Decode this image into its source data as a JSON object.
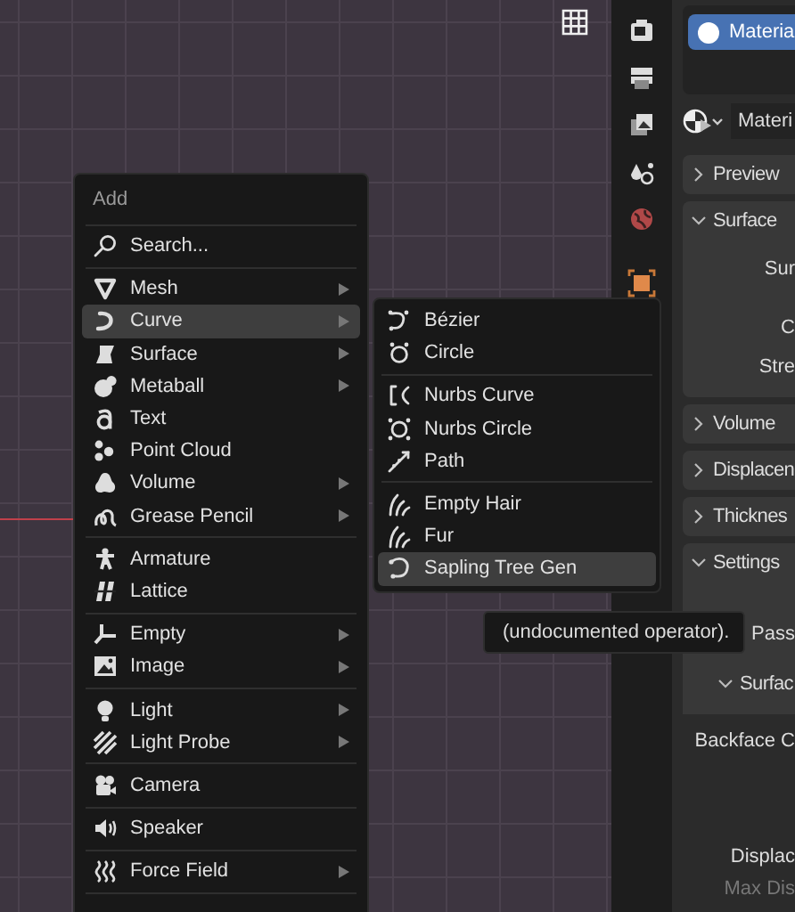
{
  "viewport": {
    "menu": {
      "title": "Add",
      "sections": [
        {
          "items": [
            {
              "label": "Search...",
              "has_submenu": false,
              "selected": false
            }
          ]
        },
        {
          "items": [
            {
              "label": "Mesh",
              "has_submenu": true,
              "selected": false
            },
            {
              "label": "Curve",
              "has_submenu": true,
              "selected": true
            },
            {
              "label": "Surface",
              "has_submenu": true,
              "selected": false
            },
            {
              "label": "Metaball",
              "has_submenu": true,
              "selected": false
            },
            {
              "label": "Text",
              "has_submenu": false,
              "selected": false
            },
            {
              "label": "Point Cloud",
              "has_submenu": false,
              "selected": false
            },
            {
              "label": "Volume",
              "has_submenu": true,
              "selected": false
            },
            {
              "label": "Grease Pencil",
              "has_submenu": true,
              "selected": false
            }
          ]
        },
        {
          "items": [
            {
              "label": "Armature",
              "has_submenu": false,
              "selected": false
            },
            {
              "label": "Lattice",
              "has_submenu": false,
              "selected": false
            }
          ]
        },
        {
          "items": [
            {
              "label": "Empty",
              "has_submenu": true,
              "selected": false
            },
            {
              "label": "Image",
              "has_submenu": true,
              "selected": false
            }
          ]
        },
        {
          "items": [
            {
              "label": "Light",
              "has_submenu": true,
              "selected": false
            },
            {
              "label": "Light Probe",
              "has_submenu": true,
              "selected": false
            }
          ]
        },
        {
          "items": [
            {
              "label": "Camera",
              "has_submenu": false,
              "selected": false
            }
          ]
        },
        {
          "items": [
            {
              "label": "Speaker",
              "has_submenu": false,
              "selected": false
            }
          ]
        },
        {
          "items": [
            {
              "label": "Force Field",
              "has_submenu": true,
              "selected": false
            }
          ]
        }
      ]
    },
    "submenu": {
      "sections": [
        {
          "items": [
            {
              "label": "Bézier",
              "selected": false
            },
            {
              "label": "Circle",
              "selected": false
            }
          ]
        },
        {
          "items": [
            {
              "label": "Nurbs Curve",
              "selected": false
            },
            {
              "label": "Nurbs Circle",
              "selected": false
            },
            {
              "label": "Path",
              "selected": false
            }
          ]
        },
        {
          "items": [
            {
              "label": "Empty Hair",
              "selected": false
            },
            {
              "label": "Fur",
              "selected": false
            },
            {
              "label": "Sapling Tree Gen",
              "selected": true
            }
          ]
        }
      ]
    },
    "tooltip": "(undocumented operator)."
  },
  "properties": {
    "material_slots": [
      {
        "label": "Materia",
        "selected": true
      }
    ],
    "material_field": "Materi",
    "panels": [
      {
        "title": "Preview",
        "expanded": false
      },
      {
        "title": "Surface",
        "expanded": true,
        "fields": [
          {
            "label": "Sur",
            "disabled": false
          },
          {
            "label": "C",
            "disabled": false
          },
          {
            "label": "Stre",
            "disabled": false
          }
        ]
      },
      {
        "title": "Volume",
        "expanded": false
      },
      {
        "title": "Displacen",
        "expanded": false
      },
      {
        "title": "Thicknes",
        "expanded": false
      },
      {
        "title": "Settings",
        "expanded": true,
        "fields": [
          {
            "label": "Pass",
            "disabled": false
          }
        ],
        "subpanels": [
          {
            "title": "Surfac",
            "expanded": true,
            "fields": [
              {
                "label": "Backface C",
                "disabled": false
              },
              {
                "label": "Displac",
                "disabled": false
              },
              {
                "label": "Max Dis",
                "disabled": true
              }
            ]
          }
        ]
      }
    ]
  }
}
